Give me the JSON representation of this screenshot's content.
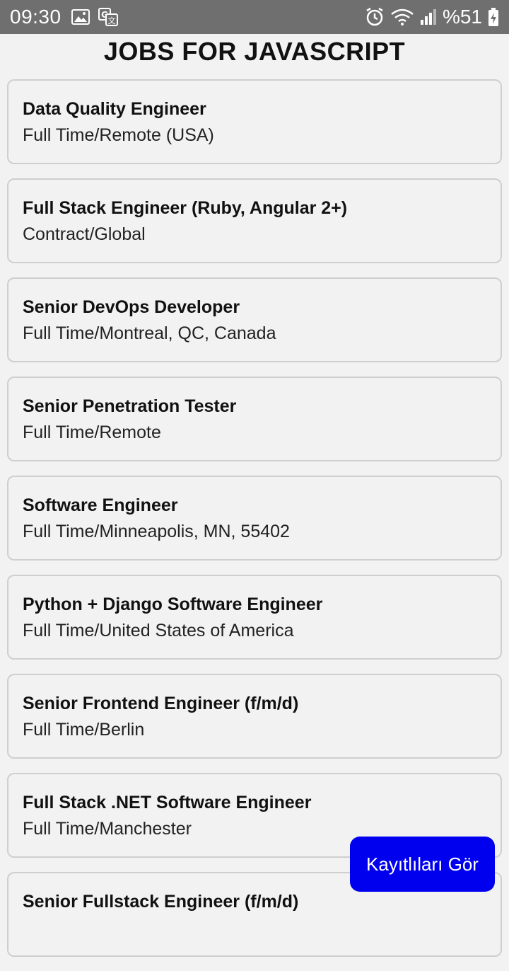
{
  "status_bar": {
    "time": "09:30",
    "battery": "%51",
    "icons": [
      "image-icon",
      "translate-icon",
      "alarm-icon",
      "wifi-icon",
      "signal-icon",
      "battery-charging-icon"
    ]
  },
  "page": {
    "title": "JOBS FOR JAVASCRIPT"
  },
  "jobs": [
    {
      "title": "Data Quality Engineer",
      "subtitle": "Full Time/Remote (USA)"
    },
    {
      "title": "Full Stack Engineer (Ruby, Angular 2+)",
      "subtitle": "Contract/Global"
    },
    {
      "title": "Senior DevOps Developer",
      "subtitle": "Full Time/Montreal, QC, Canada"
    },
    {
      "title": "Senior Penetration Tester",
      "subtitle": "Full Time/Remote"
    },
    {
      "title": "Software Engineer",
      "subtitle": "Full Time/Minneapolis, MN, 55402"
    },
    {
      "title": "Python + Django Software Engineer",
      "subtitle": "Full Time/United States of America"
    },
    {
      "title": "Senior Frontend Engineer (f/m/d)",
      "subtitle": "Full Time/Berlin"
    },
    {
      "title": "Full Stack .NET Software Engineer",
      "subtitle": "Full Time/Manchester"
    },
    {
      "title": "Senior Fullstack Engineer (f/m/d)",
      "subtitle": ""
    }
  ],
  "fab": {
    "label": "Kayıtlıları Gör",
    "color": "#0000ee"
  }
}
